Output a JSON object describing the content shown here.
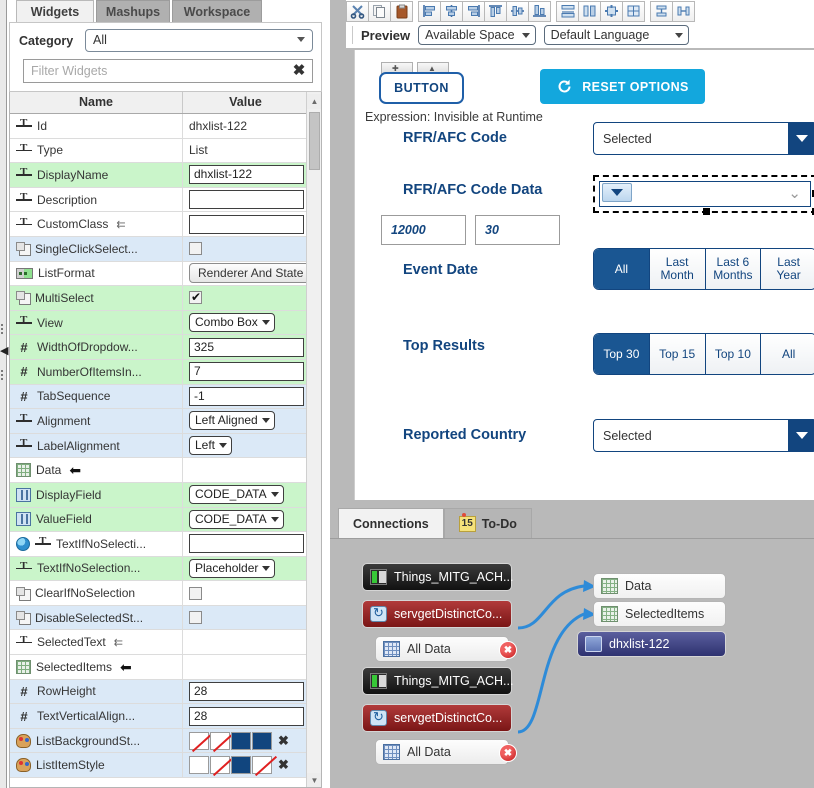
{
  "left": {
    "tabs": [
      {
        "label": "Widgets",
        "active": true
      },
      {
        "label": "Mashups",
        "active": false
      },
      {
        "label": "Workspace",
        "active": false
      }
    ],
    "category_label": "Category",
    "category_value": "All",
    "filter_placeholder": "Filter Widgets",
    "filter_value": "",
    "grid_headers": {
      "name": "Name",
      "value": "Value"
    },
    "rows": [
      {
        "icon": "text-icon",
        "name": "Id",
        "bg": "white",
        "ctl": "text",
        "value": "dhxlist-122"
      },
      {
        "icon": "text-icon",
        "name": "Type",
        "bg": "white",
        "ctl": "text",
        "value": "List"
      },
      {
        "icon": "text-icon",
        "name": "DisplayName",
        "bg": "green",
        "ctl": "input",
        "value": "dhxlist-122"
      },
      {
        "icon": "text-icon",
        "name": "Description",
        "bg": "white",
        "ctl": "input",
        "value": ""
      },
      {
        "icon": "text-icon",
        "name": "CustomClass",
        "bg": "white",
        "ctl": "input",
        "value": "",
        "bind": true
      },
      {
        "icon": "bool-icon",
        "name": "SingleClickSelect...",
        "bg": "blue",
        "ctl": "check",
        "value": "",
        "checked": false
      },
      {
        "icon": "state-icon",
        "name": "ListFormat",
        "bg": "white",
        "ctl": "button",
        "value": "Renderer And State"
      },
      {
        "icon": "bool-icon",
        "name": "MultiSelect",
        "bg": "green",
        "ctl": "check",
        "value": "",
        "checked": true
      },
      {
        "icon": "text-icon",
        "name": "View",
        "bg": "green",
        "ctl": "select",
        "value": "Combo Box"
      },
      {
        "icon": "num-icon",
        "name": "WidthOfDropdow...",
        "bg": "green",
        "ctl": "input",
        "value": "325"
      },
      {
        "icon": "num-icon",
        "name": "NumberOfItemsIn...",
        "bg": "green",
        "ctl": "input",
        "value": "7"
      },
      {
        "icon": "num-icon",
        "name": "TabSequence",
        "bg": "blue",
        "ctl": "input",
        "value": "-1"
      },
      {
        "icon": "text-icon",
        "name": "Alignment",
        "bg": "blue",
        "ctl": "select",
        "value": "Left Aligned"
      },
      {
        "icon": "text-icon",
        "name": "LabelAlignment",
        "bg": "blue",
        "ctl": "select",
        "value": "Left"
      },
      {
        "icon": "grid-icon",
        "name": "Data",
        "bg": "white",
        "ctl": "none",
        "value": "",
        "arrow": true
      },
      {
        "icon": "field-icon",
        "name": "DisplayField",
        "bg": "green",
        "ctl": "select",
        "value": "CODE_DATA"
      },
      {
        "icon": "field-icon",
        "name": "ValueField",
        "bg": "green",
        "ctl": "select",
        "value": "CODE_DATA"
      },
      {
        "icon": "globe-icon",
        "name": "TextIfNoSelecti...",
        "bg": "white",
        "ctl": "input",
        "value": ""
      },
      {
        "icon": "text-icon",
        "name": "TextIfNoSelection...",
        "bg": "green",
        "ctl": "select",
        "value": "Placeholder"
      },
      {
        "icon": "bool-icon",
        "name": "ClearIfNoSelection",
        "bg": "white",
        "ctl": "check",
        "value": "",
        "checked": false
      },
      {
        "icon": "bool-icon",
        "name": "DisableSelectedSt...",
        "bg": "blue",
        "ctl": "check",
        "value": "",
        "checked": false
      },
      {
        "icon": "text-icon",
        "name": "SelectedText",
        "bg": "white",
        "ctl": "none",
        "value": "",
        "bind": true
      },
      {
        "icon": "grid-icon",
        "name": "SelectedItems",
        "bg": "white",
        "ctl": "none",
        "value": "",
        "arrow": true
      },
      {
        "icon": "num-icon",
        "name": "RowHeight",
        "bg": "blue",
        "ctl": "input",
        "value": "28"
      },
      {
        "icon": "num-icon",
        "name": "TextVerticalAlign...",
        "bg": "blue",
        "ctl": "input",
        "value": "28"
      },
      {
        "icon": "palette-icon",
        "name": "ListBackgroundSt...",
        "bg": "blue",
        "ctl": "swatch",
        "value": "",
        "swatches": [
          "empty",
          "empty",
          "blue",
          "blue"
        ]
      },
      {
        "icon": "palette-icon",
        "name": "ListItemStyle",
        "bg": "blue",
        "ctl": "swatch",
        "value": "",
        "swatches": [
          "white",
          "empty",
          "blue",
          "empty"
        ]
      }
    ]
  },
  "toolbar": {
    "buttons": [
      {
        "name": "cut-icon",
        "title": "Cut"
      },
      {
        "name": "copy-icon",
        "title": "Copy"
      },
      {
        "name": "paste-icon",
        "title": "Paste"
      },
      {
        "name": "align-left-icon",
        "title": "Align Left"
      },
      {
        "name": "align-center-icon",
        "title": "Align Center"
      },
      {
        "name": "align-right-icon",
        "title": "Align Right"
      },
      {
        "name": "align-top-icon",
        "title": "Align Top"
      },
      {
        "name": "align-middle-icon",
        "title": "Align Middle"
      },
      {
        "name": "align-bottom-icon",
        "title": "Align Bottom"
      },
      {
        "name": "distribute-horizontal-icon",
        "title": "Distribute Horizontally"
      },
      {
        "name": "distribute-vertical-icon",
        "title": "Distribute Vertically"
      },
      {
        "name": "same-size-icon",
        "title": "Make Same Size"
      },
      {
        "name": "grid-layout-icon",
        "title": "Grid Layout"
      },
      {
        "name": "same-height-icon",
        "title": "Make Same Height"
      },
      {
        "name": "same-width-icon",
        "title": "Make Same Width"
      }
    ]
  },
  "preview": {
    "label": "Preview",
    "space_select": "Available Space",
    "language_select": "Default Language",
    "button_label": "BUTTON",
    "reset_button": "RESET OPTIONS",
    "expression_text": "Expression: Invisible at Runtime",
    "fields": {
      "rfr_code_label": "RFR/AFC Code",
      "rfr_code_value": "Selected",
      "rfr_code_data_label": "RFR/AFC Code Data",
      "rfr_code_data_value": "",
      "num1": "12000",
      "num2": "30",
      "event_date_label": "Event Date",
      "event_date_options": [
        "All",
        "Last Month",
        "Last 6 Months",
        "Last Year"
      ],
      "event_date_selected": "All",
      "top_results_label": "Top Results",
      "top_results_options": [
        "Top 30",
        "Top 15",
        "Top 10",
        "All"
      ],
      "top_results_selected": "Top 30",
      "reported_country_label": "Reported Country",
      "reported_country_value": "Selected"
    }
  },
  "connections": {
    "tabs": [
      {
        "label": "Connections",
        "active": true,
        "badge": null
      },
      {
        "label": "To-Do",
        "active": false,
        "badge": "15"
      }
    ],
    "sources": [
      {
        "type": "thing",
        "label": "Things_MITG_ACH...",
        "icon": "thing-icon"
      },
      {
        "type": "service",
        "label": "servgetDistinctCo...",
        "icon": "service-icon"
      },
      {
        "type": "alldata",
        "label": "All Data",
        "icon": "table-icon",
        "error": true
      },
      {
        "type": "thing",
        "label": "Things_MITG_ACH...",
        "icon": "thing-icon"
      },
      {
        "type": "service",
        "label": "servgetDistinctCo...",
        "icon": "service-icon"
      },
      {
        "type": "alldata",
        "label": "All Data",
        "icon": "table-icon",
        "error": true
      }
    ],
    "targets": [
      {
        "type": "target",
        "label": "Data",
        "icon": "grid-icon"
      },
      {
        "type": "target",
        "label": "SelectedItems",
        "icon": "grid-icon"
      },
      {
        "type": "widget",
        "label": "dhxlist-122",
        "icon": "widget-icon"
      }
    ]
  },
  "colors": {
    "accent_blue": "#12457f",
    "cyan_button": "#13a7dd",
    "row_green": "#caf5ca",
    "row_blue": "#dbe9f7",
    "panel_gray": "#b9b9b9",
    "link_arrow": "#2e8bd8"
  }
}
